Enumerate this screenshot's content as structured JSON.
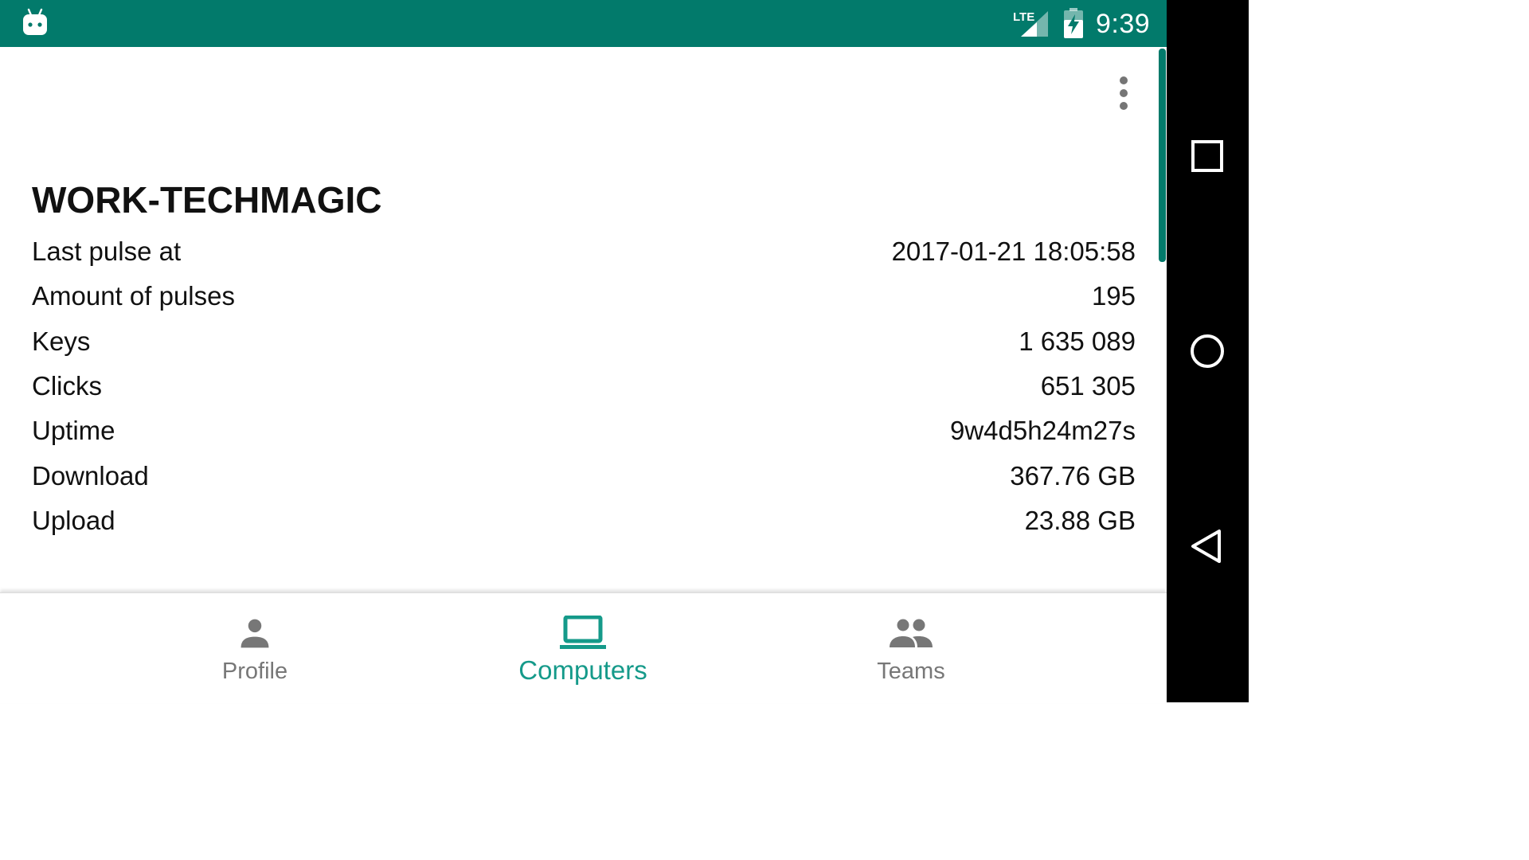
{
  "status_bar": {
    "network": "LTE",
    "time": "9:39",
    "background_color": "#027A6B"
  },
  "computer": {
    "name": "WORK-TECHMAGIC",
    "stats": [
      {
        "label": "Last pulse at",
        "value": "2017-01-21 18:05:58"
      },
      {
        "label": "Amount of pulses",
        "value": "195"
      },
      {
        "label": "Keys",
        "value": "1 635 089"
      },
      {
        "label": "Clicks",
        "value": "651 305"
      },
      {
        "label": "Uptime",
        "value": "9w4d5h24m27s"
      },
      {
        "label": "Download",
        "value": "367.76 GB"
      },
      {
        "label": "Upload",
        "value": "23.88 GB"
      }
    ]
  },
  "bottom_nav": {
    "items": [
      {
        "label": "Profile",
        "icon": "person-icon",
        "active": false
      },
      {
        "label": "Computers",
        "icon": "laptop-icon",
        "active": true
      },
      {
        "label": "Teams",
        "icon": "people-icon",
        "active": false
      }
    ],
    "active_color": "#159A8A",
    "inactive_color": "#777777"
  },
  "system_nav": {
    "buttons": [
      "recents-icon",
      "home-icon",
      "back-icon"
    ]
  }
}
